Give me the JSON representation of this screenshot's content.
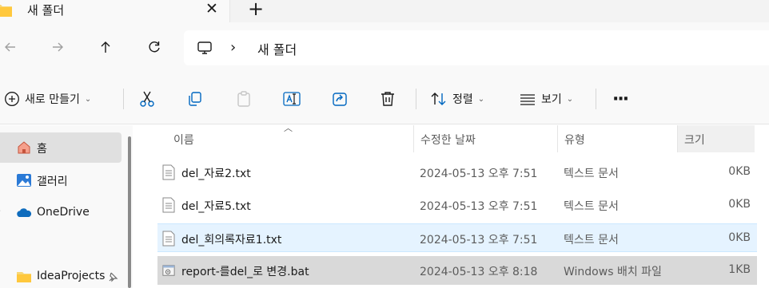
{
  "tab": {
    "title": "새 폴더",
    "close_glyph": "✕",
    "new_tab_glyph": "+"
  },
  "address": {
    "separator": "›",
    "crumbs": [
      "새 폴더"
    ]
  },
  "commands": {
    "new_label": "새로 만들기",
    "sort_label": "정렬",
    "view_label": "보기",
    "more_glyph": "···"
  },
  "sidebar": {
    "items": [
      {
        "label": "홈",
        "icon": "home-icon",
        "selected": true
      },
      {
        "label": "갤러리",
        "icon": "gallery-icon"
      },
      {
        "label": "OneDrive",
        "icon": "onedrive-icon"
      },
      {
        "label": "IdeaProjects",
        "icon": "folder-icon",
        "pinned": true
      }
    ]
  },
  "columns": {
    "name": "이름",
    "date": "수정한 날짜",
    "type": "유형",
    "size": "크기"
  },
  "files": [
    {
      "name": "del_자료2.txt",
      "date": "2024-05-13 오후 7:51",
      "type": "텍스트 문서",
      "size": "0KB",
      "icon": "text-file-icon"
    },
    {
      "name": "del_자료5.txt",
      "date": "2024-05-13 오후 7:51",
      "type": "텍스트 문서",
      "size": "0KB",
      "icon": "text-file-icon"
    },
    {
      "name": "del_회의록자료1.txt",
      "date": "2024-05-13 오후 7:51",
      "type": "텍스트 문서",
      "size": "0KB",
      "icon": "text-file-icon"
    },
    {
      "name": "report-를del_로 변경.bat",
      "date": "2024-05-13 오후 8:18",
      "type": "Windows 배치 파일",
      "size": "1KB",
      "icon": "batch-file-icon"
    }
  ],
  "colors": {
    "accent": "#0067c0",
    "folder": "#f8d775",
    "hover": "#e5f3ff",
    "selected": "#d9d9d9"
  }
}
